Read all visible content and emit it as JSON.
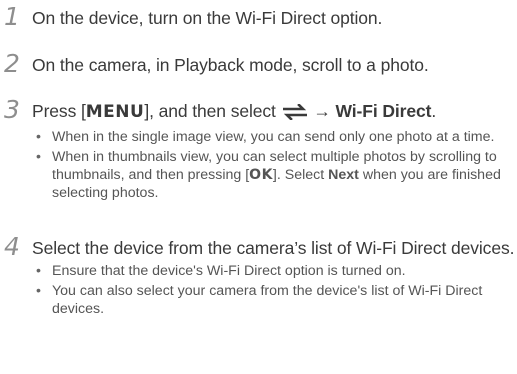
{
  "steps": [
    {
      "number": "1",
      "text": "On the device, turn on the Wi-Fi Direct option."
    },
    {
      "number": "2",
      "text": "On the camera, in Playback mode, scroll to a photo."
    },
    {
      "number": "3",
      "text_press": "Press [",
      "menu_key": "MENU",
      "text_select": "], and then select",
      "arrow": "→",
      "target": "Wi-Fi Direct",
      "end": ".",
      "share_icon": "share-arrows-icon",
      "bullets": [
        {
          "text": "When in the single image view, you can send only one photo at a time."
        },
        {
          "part1": "When in thumbnails view, you can select multiple photos by scrolling to thumbnails, and then pressing [",
          "ok_key": "OK",
          "part2": "]. Select ",
          "next": "Next",
          "part3": " when you are finished selecting photos."
        }
      ]
    },
    {
      "number": "4",
      "text": "Select the device from the camera’s list of Wi-Fi Direct devices.",
      "bullets": [
        {
          "text": "Ensure that the device's Wi-Fi Direct option is turned on."
        },
        {
          "text": "You can also select your camera from the device's list of Wi-Fi Direct devices."
        }
      ]
    }
  ],
  "colors": {
    "step_number": "#8e8e8e",
    "text": "#3a3a3a",
    "bullet_text": "#555555"
  }
}
